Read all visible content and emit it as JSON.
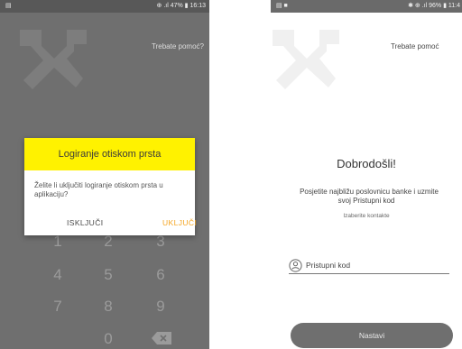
{
  "left_screen": {
    "status_bar": {
      "left": "▤",
      "right": "⊕ .ıl 47% ▮ 16:13"
    },
    "help_link": "Trebate pomoć?",
    "dialog": {
      "title": "Logiranje otiskom prsta",
      "message": "Želite li uključiti logiranje otiskom prsta u aplikaciju?",
      "off_button": "ISKLJUČI",
      "on_button": "UKLJUČI"
    },
    "keypad": {
      "keys": [
        "1",
        "2",
        "3",
        "4",
        "5",
        "6",
        "7",
        "8",
        "9",
        "0"
      ],
      "backspace_icon": "backspace-icon"
    }
  },
  "right_screen": {
    "status_bar": {
      "left": "▤ ■",
      "right": "✱ ⊕ .ıl 96% ▮ 11:4"
    },
    "help_link": "Trebate pomoć",
    "welcome": "Dobrodošli!",
    "instructions_line1": "Posjetite najbližu poslovnicu banke i uzmite",
    "instructions_line2": "svoj Pristupni kod",
    "choose_contacts": "Izaberite kontakte",
    "access_code_label": "Pristupni kod",
    "continue_button": "Nastavi"
  },
  "colors": {
    "dialog_header": "#fff200",
    "enable_button": "#f5a623",
    "continue_button": "#6f6f6f"
  }
}
